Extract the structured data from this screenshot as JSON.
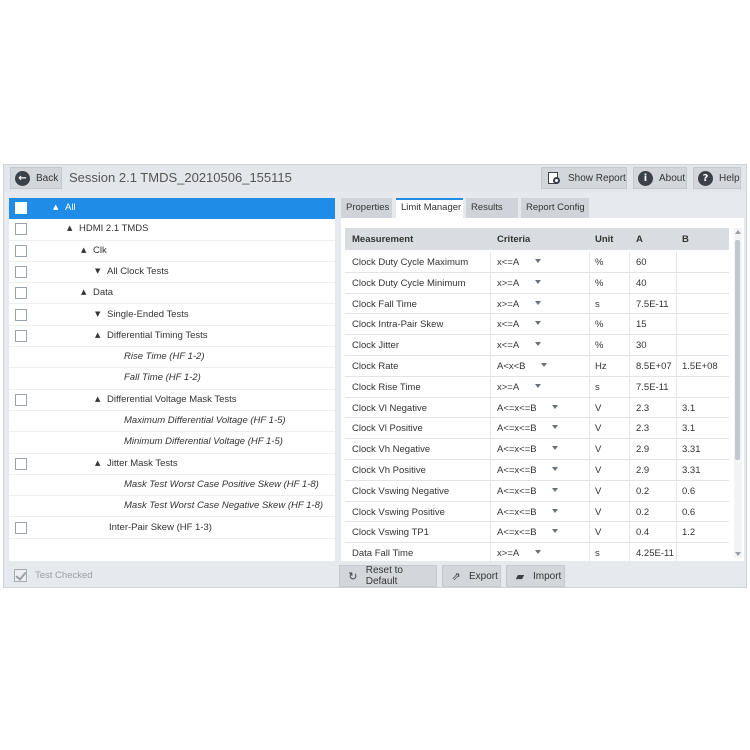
{
  "header": {
    "back_label": "Back",
    "session_title": "Session  2.1 TMDS_20210506_155115",
    "show_report_label": "Show Report",
    "about_label": "About",
    "help_label": "Help",
    "about_glyph": "i",
    "help_glyph": "?",
    "back_glyph": "←"
  },
  "tree": {
    "rows": [
      {
        "label": "All",
        "checkbox": true,
        "arrow": "▲",
        "selected": true
      },
      {
        "label": "HDMI 2.1 TMDS",
        "checkbox": true,
        "arrow": "▲"
      },
      {
        "label": "Clk",
        "checkbox": true,
        "arrow": "▲"
      },
      {
        "label": "All Clock Tests",
        "checkbox": true,
        "arrow": "▼"
      },
      {
        "label": "Data",
        "checkbox": true,
        "arrow": "▲"
      },
      {
        "label": "Single-Ended Tests",
        "checkbox": true,
        "arrow": "▼"
      },
      {
        "label": "Differential Timing Tests",
        "checkbox": true,
        "arrow": "▲"
      },
      {
        "label": "Rise Time (HF 1-2)",
        "checkbox": false,
        "italic": true
      },
      {
        "label": "Fall Time (HF 1-2)",
        "checkbox": false,
        "italic": true
      },
      {
        "label": "Differential Voltage Mask Tests",
        "checkbox": true,
        "arrow": "▲"
      },
      {
        "label": "Maximum Differential Voltage (HF 1-5)",
        "checkbox": false,
        "italic": true
      },
      {
        "label": "Minimum Differential Voltage (HF 1-5)",
        "checkbox": false,
        "italic": true
      },
      {
        "label": "Jitter Mask Tests",
        "checkbox": true,
        "arrow": "▲"
      },
      {
        "label": "Mask Test Worst Case Positive Skew (HF 1-8)",
        "checkbox": false,
        "italic": true
      },
      {
        "label": "Mask Test Worst Case Negative Skew (HF 1-8)",
        "checkbox": false,
        "italic": true
      },
      {
        "label": "Inter-Pair Skew (HF 1-3)",
        "checkbox": true
      }
    ],
    "test_checked_label": "Test Checked"
  },
  "tabs": [
    "Properties",
    "Limit Manager",
    "Results",
    "Report Config"
  ],
  "active_tab": "Limit Manager",
  "limits": {
    "columns": [
      "Measurement",
      "Criteria",
      "Unit",
      "A",
      "B"
    ],
    "rows": [
      [
        "Clock Duty Cycle Maximum",
        "x<=A",
        "%",
        "60",
        ""
      ],
      [
        "Clock Duty Cycle Minimum",
        "x>=A",
        "%",
        "40",
        ""
      ],
      [
        "Clock Fall Time",
        "x>=A",
        "s",
        "7.5E-11",
        ""
      ],
      [
        "Clock Intra-Pair Skew",
        "x<=A",
        "%",
        "15",
        ""
      ],
      [
        "Clock Jitter",
        "x<=A",
        "%",
        "30",
        ""
      ],
      [
        "Clock Rate",
        "A<x<B",
        "Hz",
        "8.5E+07",
        "1.5E+08"
      ],
      [
        "Clock Rise Time",
        "x>=A",
        "s",
        "7.5E-11",
        ""
      ],
      [
        "Clock Vl Negative",
        "A<=x<=B",
        "V",
        "2.3",
        "3.1"
      ],
      [
        "Clock Vl Positive",
        "A<=x<=B",
        "V",
        "2.3",
        "3.1"
      ],
      [
        "Clock Vh Negative",
        "A<=x<=B",
        "V",
        "2.9",
        "3.31"
      ],
      [
        "Clock Vh Positive",
        "A<=x<=B",
        "V",
        "2.9",
        "3.31"
      ],
      [
        "Clock Vswing Negative",
        "A<=x<=B",
        "V",
        "0.2",
        "0.6"
      ],
      [
        "Clock Vswing Positive",
        "A<=x<=B",
        "V",
        "0.2",
        "0.6"
      ],
      [
        "Clock Vswing TP1",
        "A<=x<=B",
        "V",
        "0.4",
        "1.2"
      ],
      [
        "Data Fall Time",
        "x>=A",
        "s",
        "4.25E-11",
        ""
      ]
    ]
  },
  "footer": {
    "reset_label": "Reset to Default",
    "export_label": "Export",
    "import_label": "Import"
  },
  "colors": {
    "accent": "#1f8ce8",
    "toolbar": "#e3e6ea",
    "button": "#d3d7dc"
  }
}
